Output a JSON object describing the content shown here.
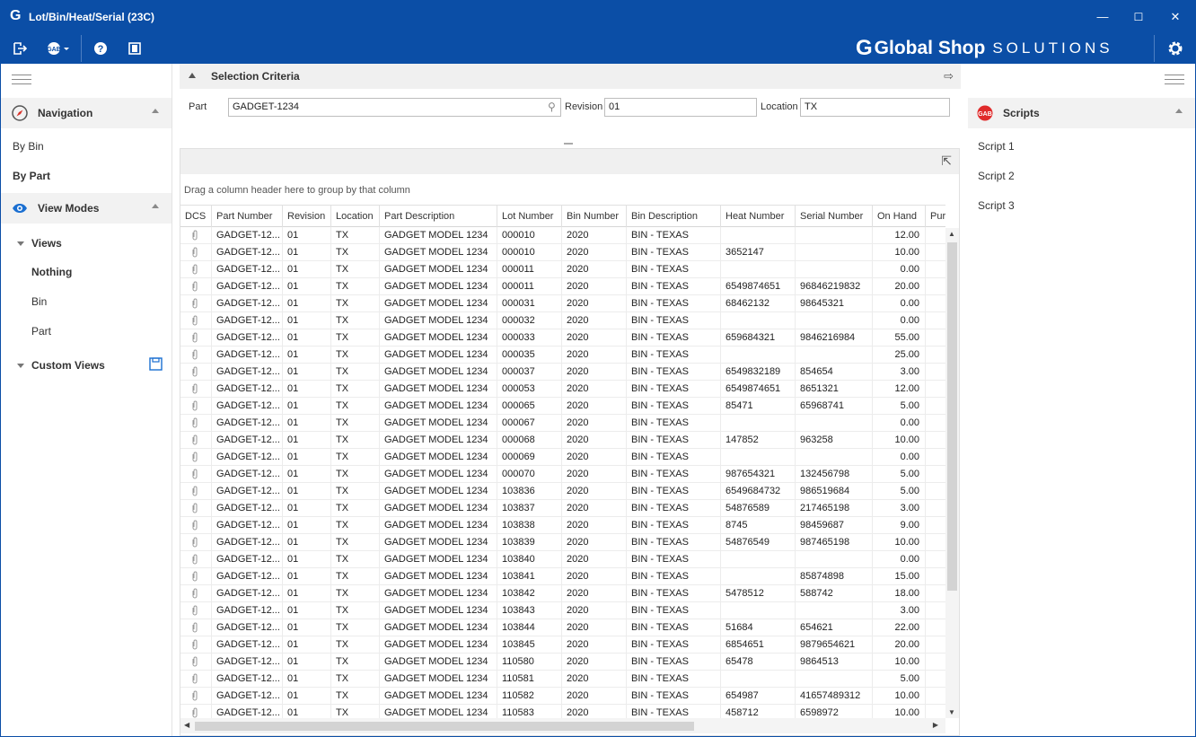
{
  "window": {
    "title": "Lot/Bin/Heat/Serial (23C)",
    "minimize": "—",
    "maximize": "☐",
    "close": "✕",
    "accent": "#0b4ea6"
  },
  "toolbar": {
    "brand_g": "G",
    "brand_name": "Global Shop",
    "brand_solutions": "SOLUTIONS"
  },
  "navigation": {
    "header": "Navigation",
    "items": [
      "By Bin",
      "By Part"
    ]
  },
  "view_modes": {
    "header": "View Modes",
    "views_label": "Views",
    "views": [
      "Nothing",
      "Bin",
      "Part"
    ],
    "custom_views_label": "Custom Views"
  },
  "scripts": {
    "header": "Scripts",
    "items": [
      "Script 1",
      "Script 2",
      "Script 3"
    ]
  },
  "selection": {
    "header": "Selection Criteria",
    "part_label": "Part",
    "part_value": "GADGET-1234",
    "revision_label": "Revision",
    "revision_value": "01",
    "location_label": "Location",
    "location_value": "TX"
  },
  "grid": {
    "group_hint": "Drag a column header here to group by that column",
    "columns": [
      "DCS",
      "Part Number",
      "Revision",
      "Location",
      "Part Description",
      "Lot Number",
      "Bin Number",
      "Bin Description",
      "Heat Number",
      "Serial Number",
      "On Hand",
      "Purcha"
    ],
    "rows": [
      [
        "GADGET-12...",
        "01",
        "TX",
        "GADGET MODEL 1234",
        "000010",
        "2020",
        "BIN - TEXAS",
        "",
        "",
        "12.00"
      ],
      [
        "GADGET-12...",
        "01",
        "TX",
        "GADGET MODEL 1234",
        "000010",
        "2020",
        "BIN - TEXAS",
        "3652147",
        "",
        "10.00"
      ],
      [
        "GADGET-12...",
        "01",
        "TX",
        "GADGET MODEL 1234",
        "000011",
        "2020",
        "BIN - TEXAS",
        "",
        "",
        "0.00"
      ],
      [
        "GADGET-12...",
        "01",
        "TX",
        "GADGET MODEL 1234",
        "000011",
        "2020",
        "BIN - TEXAS",
        "6549874651",
        "96846219832",
        "20.00"
      ],
      [
        "GADGET-12...",
        "01",
        "TX",
        "GADGET MODEL 1234",
        "000031",
        "2020",
        "BIN - TEXAS",
        "68462132",
        "98645321",
        "0.00"
      ],
      [
        "GADGET-12...",
        "01",
        "TX",
        "GADGET MODEL 1234",
        "000032",
        "2020",
        "BIN - TEXAS",
        "",
        "",
        "0.00"
      ],
      [
        "GADGET-12...",
        "01",
        "TX",
        "GADGET MODEL 1234",
        "000033",
        "2020",
        "BIN - TEXAS",
        "659684321",
        "9846216984",
        "55.00"
      ],
      [
        "GADGET-12...",
        "01",
        "TX",
        "GADGET MODEL 1234",
        "000035",
        "2020",
        "BIN - TEXAS",
        "",
        "",
        "25.00"
      ],
      [
        "GADGET-12...",
        "01",
        "TX",
        "GADGET MODEL 1234",
        "000037",
        "2020",
        "BIN - TEXAS",
        "6549832189",
        "854654",
        "3.00"
      ],
      [
        "GADGET-12...",
        "01",
        "TX",
        "GADGET MODEL 1234",
        "000053",
        "2020",
        "BIN - TEXAS",
        "6549874651",
        "8651321",
        "12.00"
      ],
      [
        "GADGET-12...",
        "01",
        "TX",
        "GADGET MODEL 1234",
        "000065",
        "2020",
        "BIN - TEXAS",
        "85471",
        "65968741",
        "5.00"
      ],
      [
        "GADGET-12...",
        "01",
        "TX",
        "GADGET MODEL 1234",
        "000067",
        "2020",
        "BIN - TEXAS",
        "",
        "",
        "0.00"
      ],
      [
        "GADGET-12...",
        "01",
        "TX",
        "GADGET MODEL 1234",
        "000068",
        "2020",
        "BIN - TEXAS",
        "147852",
        "963258",
        "10.00"
      ],
      [
        "GADGET-12...",
        "01",
        "TX",
        "GADGET MODEL 1234",
        "000069",
        "2020",
        "BIN - TEXAS",
        "",
        "",
        "0.00"
      ],
      [
        "GADGET-12...",
        "01",
        "TX",
        "GADGET MODEL 1234",
        "000070",
        "2020",
        "BIN - TEXAS",
        "987654321",
        "132456798",
        "5.00"
      ],
      [
        "GADGET-12...",
        "01",
        "TX",
        "GADGET MODEL 1234",
        "103836",
        "2020",
        "BIN - TEXAS",
        "6549684732",
        "986519684",
        "5.00"
      ],
      [
        "GADGET-12...",
        "01",
        "TX",
        "GADGET MODEL 1234",
        "103837",
        "2020",
        "BIN - TEXAS",
        "54876589",
        "217465198",
        "3.00"
      ],
      [
        "GADGET-12...",
        "01",
        "TX",
        "GADGET MODEL 1234",
        "103838",
        "2020",
        "BIN - TEXAS",
        "8745",
        "98459687",
        "9.00"
      ],
      [
        "GADGET-12...",
        "01",
        "TX",
        "GADGET MODEL 1234",
        "103839",
        "2020",
        "BIN - TEXAS",
        "54876549",
        "987465198",
        "10.00"
      ],
      [
        "GADGET-12...",
        "01",
        "TX",
        "GADGET MODEL 1234",
        "103840",
        "2020",
        "BIN - TEXAS",
        "",
        "",
        "0.00"
      ],
      [
        "GADGET-12...",
        "01",
        "TX",
        "GADGET MODEL 1234",
        "103841",
        "2020",
        "BIN - TEXAS",
        "",
        "85874898",
        "15.00"
      ],
      [
        "GADGET-12...",
        "01",
        "TX",
        "GADGET MODEL 1234",
        "103842",
        "2020",
        "BIN - TEXAS",
        "5478512",
        "588742",
        "18.00"
      ],
      [
        "GADGET-12...",
        "01",
        "TX",
        "GADGET MODEL 1234",
        "103843",
        "2020",
        "BIN - TEXAS",
        "",
        "",
        "3.00"
      ],
      [
        "GADGET-12...",
        "01",
        "TX",
        "GADGET MODEL 1234",
        "103844",
        "2020",
        "BIN - TEXAS",
        "51684",
        "654621",
        "22.00"
      ],
      [
        "GADGET-12...",
        "01",
        "TX",
        "GADGET MODEL 1234",
        "103845",
        "2020",
        "BIN - TEXAS",
        "6854651",
        "9879654621",
        "20.00"
      ],
      [
        "GADGET-12...",
        "01",
        "TX",
        "GADGET MODEL 1234",
        "110580",
        "2020",
        "BIN - TEXAS",
        "65478",
        "9864513",
        "10.00"
      ],
      [
        "GADGET-12...",
        "01",
        "TX",
        "GADGET MODEL 1234",
        "110581",
        "2020",
        "BIN - TEXAS",
        "",
        "",
        "5.00"
      ],
      [
        "GADGET-12...",
        "01",
        "TX",
        "GADGET MODEL 1234",
        "110582",
        "2020",
        "BIN - TEXAS",
        "654987",
        "41657489312",
        "10.00"
      ],
      [
        "GADGET-12...",
        "01",
        "TX",
        "GADGET MODEL 1234",
        "110583",
        "2020",
        "BIN - TEXAS",
        "458712",
        "6598972",
        "10.00"
      ]
    ]
  },
  "icons": {
    "app": "g-logo-icon",
    "exit": "exit-icon",
    "gab": "gab-menu-icon",
    "help": "help-icon",
    "panel": "panel-toggle-icon",
    "settings": "gear-icon",
    "navigation": "compass-icon",
    "view_modes": "eye-icon",
    "save": "save-icon",
    "scripts": "gab-script-icon",
    "attachment": "paperclip-icon",
    "search": "search-icon",
    "popout": "popout-icon"
  }
}
